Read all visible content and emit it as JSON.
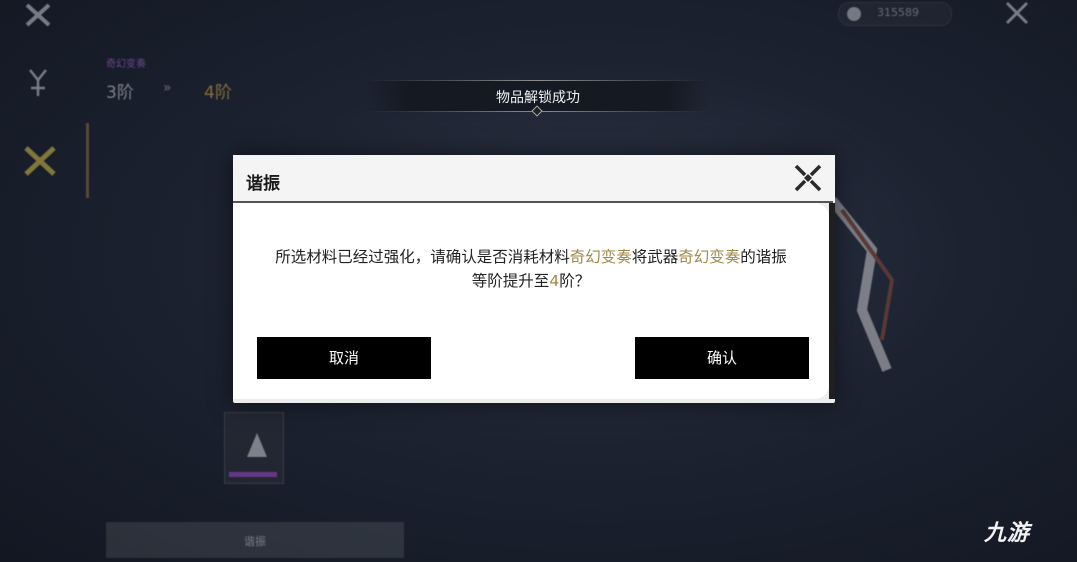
{
  "background": {
    "top_right_currency": "315589",
    "item_name": "奇幻变奏",
    "level_from": "3阶",
    "level_to": "4阶",
    "arrow": "»",
    "enhance_button": "谐振"
  },
  "toast": {
    "text": "物品解锁成功"
  },
  "dialog": {
    "title": "谐振",
    "message_parts": {
      "p1": "所选材料已经过强化，请确认是否消耗材料",
      "material": "奇幻变奏",
      "p2": "将武器",
      "weapon": "奇幻变奏",
      "p3": "的谐振",
      "p4": "等阶提升至",
      "level": "4",
      "p5": "阶？"
    },
    "cancel_label": "取消",
    "confirm_label": "确认"
  },
  "watermark": "九游",
  "colors": {
    "highlight": "#a08a48",
    "rarity_purple": "#a54fd1",
    "level_gold": "#d8b24a"
  }
}
